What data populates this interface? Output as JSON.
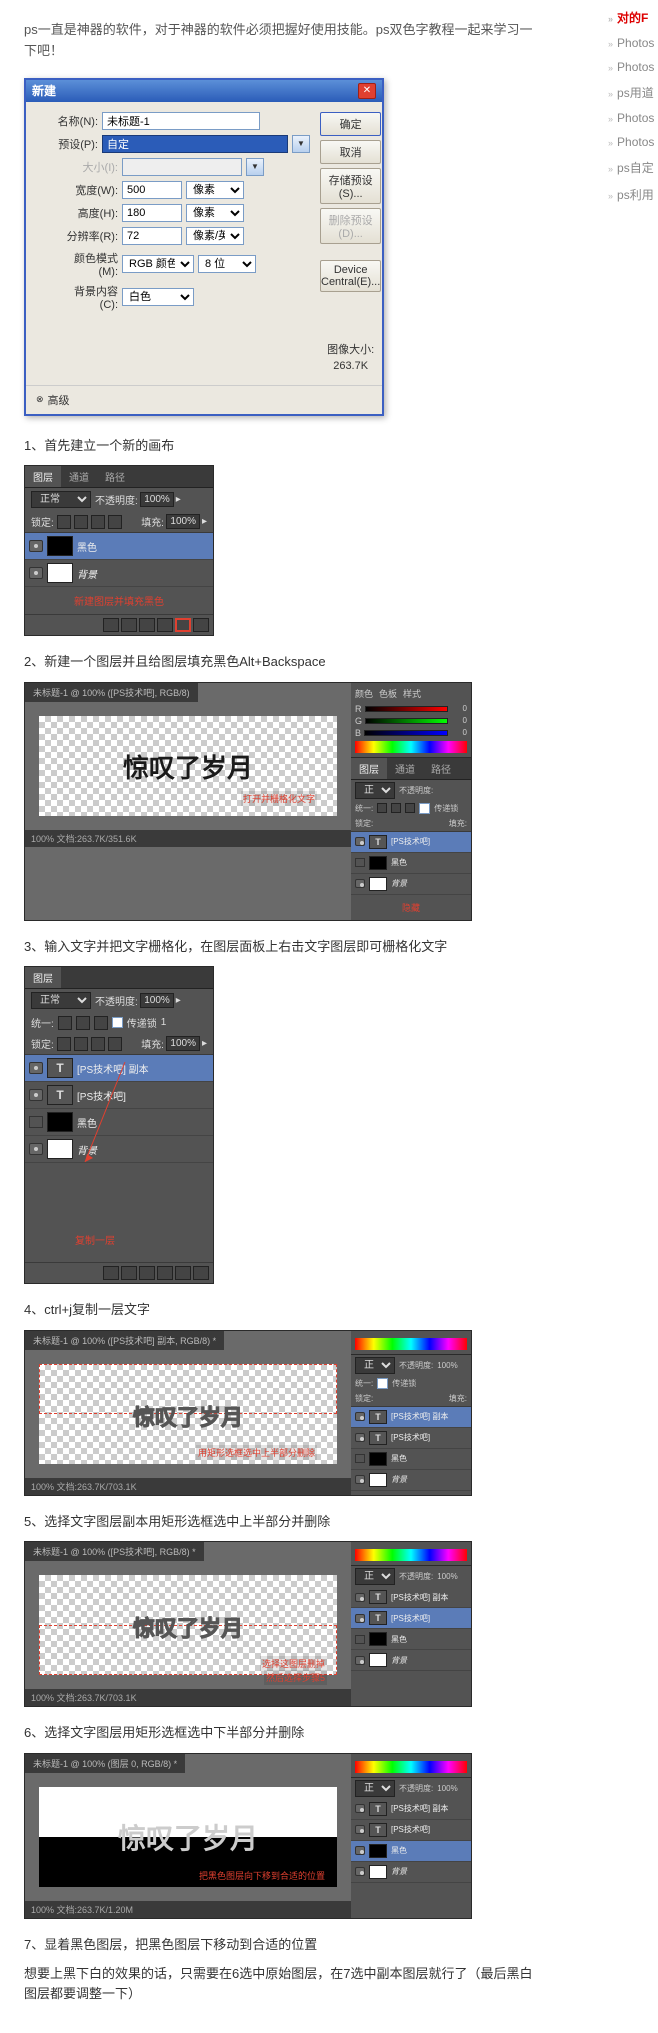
{
  "intro_text": "ps一直是神器的软件，对于神器的软件必须把握好使用技能。ps双色字教程一起来学习一下吧！",
  "sidebar": {
    "items": [
      {
        "label": "对的F",
        "active": true
      },
      {
        "label": "Photos"
      },
      {
        "label": "Photos"
      },
      {
        "label": "ps用道"
      },
      {
        "label": "Photos"
      },
      {
        "label": "Photos"
      },
      {
        "label": "ps自定"
      },
      {
        "label": "ps利用"
      }
    ]
  },
  "dialog": {
    "title": "新建",
    "name_label": "名称(N):",
    "name_value": "未标题-1",
    "preset_label": "预设(P):",
    "preset_value": "自定",
    "size_label": "大小(I):",
    "width_label": "宽度(W):",
    "width_value": "500",
    "width_unit": "像素",
    "height_label": "高度(H):",
    "height_value": "180",
    "height_unit": "像素",
    "res_label": "分辨率(R):",
    "res_value": "72",
    "res_unit": "像素/英寸",
    "mode_label": "颜色模式(M):",
    "mode_value": "RGB 颜色",
    "bits_value": "8 位",
    "bg_label": "背景内容(C):",
    "bg_value": "白色",
    "advanced": "高级",
    "btn_ok": "确定",
    "btn_cancel": "取消",
    "btn_save": "存储预设(S)...",
    "btn_delete": "删除预设(D)...",
    "btn_device": "Device Central(E)...",
    "img_size_label": "图像大小:",
    "img_size_value": "263.7K"
  },
  "steps": {
    "s1": "1、首先建立一个新的画布",
    "s2": "2、新建一个图层并且给图层填充黑色Alt+Backspace",
    "s3": "3、输入文字并把文字栅格化，在图层面板上右击文字图层即可栅格化文字",
    "s4": "4、ctrl+j复制一层文字",
    "s5": "5、选择文字图层副本用矩形选框选中上半部分并删除",
    "s6": "6、选择文字图层用矩形选框选中下半部分并删除",
    "s7": "7、显着黑色图层，把黑色图层下移动到合适的位置",
    "s7_sub": "想要上黑下白的效果的话，只需要在6选中原始图层，在7选中副本图层就行了（最后黑白图层都要调整一下）"
  },
  "panel1": {
    "tabs": [
      "图层",
      "通道",
      "路径"
    ],
    "blend": "正常",
    "opacity_label": "不透明度:",
    "opacity_value": "100%",
    "lock_label": "锁定:",
    "fill_label": "填充:",
    "fill_value": "100%",
    "layers": [
      {
        "name": "黑色",
        "thumb": "black",
        "selected": true
      },
      {
        "name": "背景",
        "thumb": "white",
        "italic": true
      }
    ],
    "annotation": "新建图层并填充黑色"
  },
  "workspace2": {
    "tab": "未标题-1 @ 100% ([PS技术吧], RGB/8)",
    "text_content": "惊叹了岁月",
    "annotation1": "打开并栅格化文字",
    "annotation2": "隐藏",
    "status": "100%    文档:263.7K/351.6K",
    "color_tabs": [
      "颜色",
      "色板",
      "样式"
    ],
    "rgb": {
      "r": "0",
      "g": "0",
      "b": "0"
    },
    "layers_tabs": [
      "图层",
      "通道",
      "路径"
    ],
    "blend": "正常",
    "opacity_label": "不透明度:",
    "pass_label": "传递锁",
    "unify_label": "统一:",
    "lock_label": "锁定:",
    "fill_label": "填充:",
    "layers": [
      {
        "name": "[PS技术吧]",
        "thumb": "text",
        "selected": true
      },
      {
        "name": "黑色",
        "thumb": "black"
      },
      {
        "name": "背景",
        "thumb": "white",
        "italic": true
      }
    ]
  },
  "panel3": {
    "tabs": [
      "图层"
    ],
    "blend": "正常",
    "opacity_label": "不透明度:",
    "opacity_value": "100%",
    "pass_label": "传递锁",
    "pass_value": "1",
    "unify_label": "统一:",
    "lock_label": "锁定:",
    "fill_label": "填充:",
    "fill_value": "100%",
    "layers": [
      {
        "name": "[PS技术吧] 副本",
        "thumb": "text",
        "selected": true
      },
      {
        "name": "[PS技术吧]",
        "thumb": "text"
      },
      {
        "name": "黑色",
        "thumb": "black"
      },
      {
        "name": "背景",
        "thumb": "white",
        "italic": true
      }
    ],
    "annotation": "复制一层"
  },
  "workspace4": {
    "tab": "未标题-1 @ 100% ([PS技术吧] 副本, RGB/8) *",
    "text_content": "惊叹了岁月",
    "annotation": "用矩形选框选中上半部分删除",
    "status": "100%    文档:263.7K/703.1K",
    "blend": "正常",
    "opacity_label": "不透明度:",
    "opacity_value": "100%",
    "pass_label": "传递锁",
    "unify_label": "统一:",
    "lock_label": "锁定:",
    "fill_label": "填充:",
    "layers": [
      {
        "name": "[PS技术吧] 副本",
        "thumb": "text",
        "selected": true
      },
      {
        "name": "[PS技术吧]",
        "thumb": "text"
      },
      {
        "name": "黑色",
        "thumb": "black"
      },
      {
        "name": "背景",
        "thumb": "white",
        "italic": true
      }
    ]
  },
  "workspace5": {
    "tab": "未标题-1 @ 100% ([PS技术吧], RGB/8) *",
    "text_content": "惊叹了岁月",
    "annotation1": "选择这图层删掉",
    "annotation2": "然后选择步骤5",
    "status": "100%    文档:263.7K/703.1K",
    "blend": "正常",
    "opacity_label": "不透明度:",
    "opacity_value": "100%",
    "layers": [
      {
        "name": "[PS技术吧] 副本",
        "thumb": "text"
      },
      {
        "name": "[PS技术吧]",
        "thumb": "text",
        "selected": true
      },
      {
        "name": "黑色",
        "thumb": "black"
      },
      {
        "name": "背景",
        "thumb": "white",
        "italic": true
      }
    ]
  },
  "workspace6": {
    "tab": "未标题-1 @ 100% (图层 0, RGB/8) *",
    "text_content": "惊叹了岁月",
    "annotation": "把黑色图层向下移到合适的位置",
    "status": "100%    文档:263.7K/1.20M",
    "blend": "正常",
    "opacity_label": "不透明度:",
    "opacity_value": "100%",
    "layers": [
      {
        "name": "[PS技术吧] 副本",
        "thumb": "text"
      },
      {
        "name": "[PS技术吧]",
        "thumb": "text"
      },
      {
        "name": "黑色",
        "thumb": "black",
        "selected": true
      },
      {
        "name": "背景",
        "thumb": "white",
        "italic": true
      }
    ]
  }
}
